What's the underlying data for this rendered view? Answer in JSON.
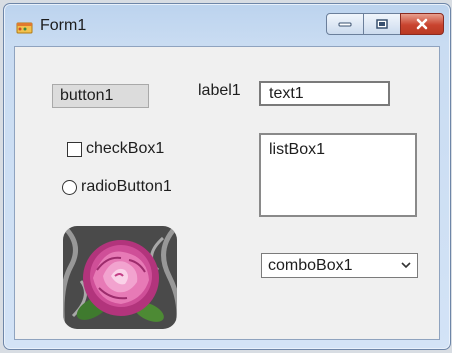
{
  "window": {
    "title": "Form1",
    "icons": {
      "app": "form-app-icon",
      "minimize": "minimize-icon",
      "maximize": "maximize-icon",
      "close": "close-icon"
    }
  },
  "form": {
    "button1": {
      "label": "button1"
    },
    "label1": {
      "text": "label1"
    },
    "text1": {
      "value": "text1"
    },
    "checkBox1": {
      "label": "checkBox1",
      "checked": false
    },
    "radioButton1": {
      "label": "radioButton1",
      "selected": false
    },
    "listBox1": {
      "items": [
        "listBox1"
      ]
    },
    "pictureBox1": {
      "content": "pink rose photograph"
    },
    "comboBox1": {
      "selected": "comboBox1"
    }
  },
  "colors": {
    "title_bar": "#c4d8f0",
    "close_button": "#c9442f",
    "client_bg": "#f0f0f0"
  }
}
